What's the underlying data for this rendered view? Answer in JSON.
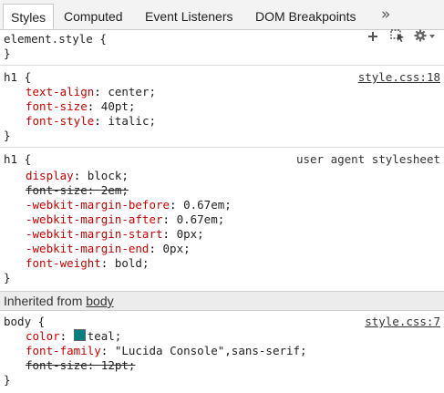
{
  "tabs": [
    {
      "label": "Styles",
      "selected": true
    },
    {
      "label": "Computed"
    },
    {
      "label": "Event Listeners"
    },
    {
      "label": "DOM Breakpoints"
    }
  ],
  "overflow_icon": "»",
  "element_style": {
    "selector": "element.style {",
    "close": "}"
  },
  "toolbar_icons": [
    "plus-icon",
    "element-state-icon",
    "gear-icon"
  ],
  "rule1": {
    "selector": "h1 {",
    "source": "style.css:18",
    "props": [
      {
        "name": "text-align",
        "value": "center;"
      },
      {
        "name": "font-size",
        "value": "40pt;"
      },
      {
        "name": "font-style",
        "value": "italic;"
      }
    ],
    "close": "}"
  },
  "rule2": {
    "selector": "h1 {",
    "source": "user agent stylesheet",
    "props": [
      {
        "name": "display",
        "value": "block;"
      },
      {
        "name": "font-size",
        "value": "2em;",
        "overridden": true
      },
      {
        "name": "-webkit-margin-before",
        "value": "0.67em;"
      },
      {
        "name": "-webkit-margin-after",
        "value": "0.67em;"
      },
      {
        "name": "-webkit-margin-start",
        "value": "0px;"
      },
      {
        "name": "-webkit-margin-end",
        "value": "0px;"
      },
      {
        "name": "font-weight",
        "value": "bold;"
      }
    ],
    "close": "}"
  },
  "inherited": {
    "prefix": "Inherited from ",
    "element": "body"
  },
  "rule3": {
    "selector": "body {",
    "source": "style.css:7",
    "props": [
      {
        "name": "color",
        "value": "teal;",
        "swatch": "#008080"
      },
      {
        "name": "font-family",
        "value": "\"Lucida Console\",sans-serif;"
      },
      {
        "name": "font-size",
        "value": "12pt;",
        "overridden": true
      }
    ],
    "close": "}"
  },
  "colors": {
    "property": "#c80000",
    "teal_swatch": "#008080"
  }
}
